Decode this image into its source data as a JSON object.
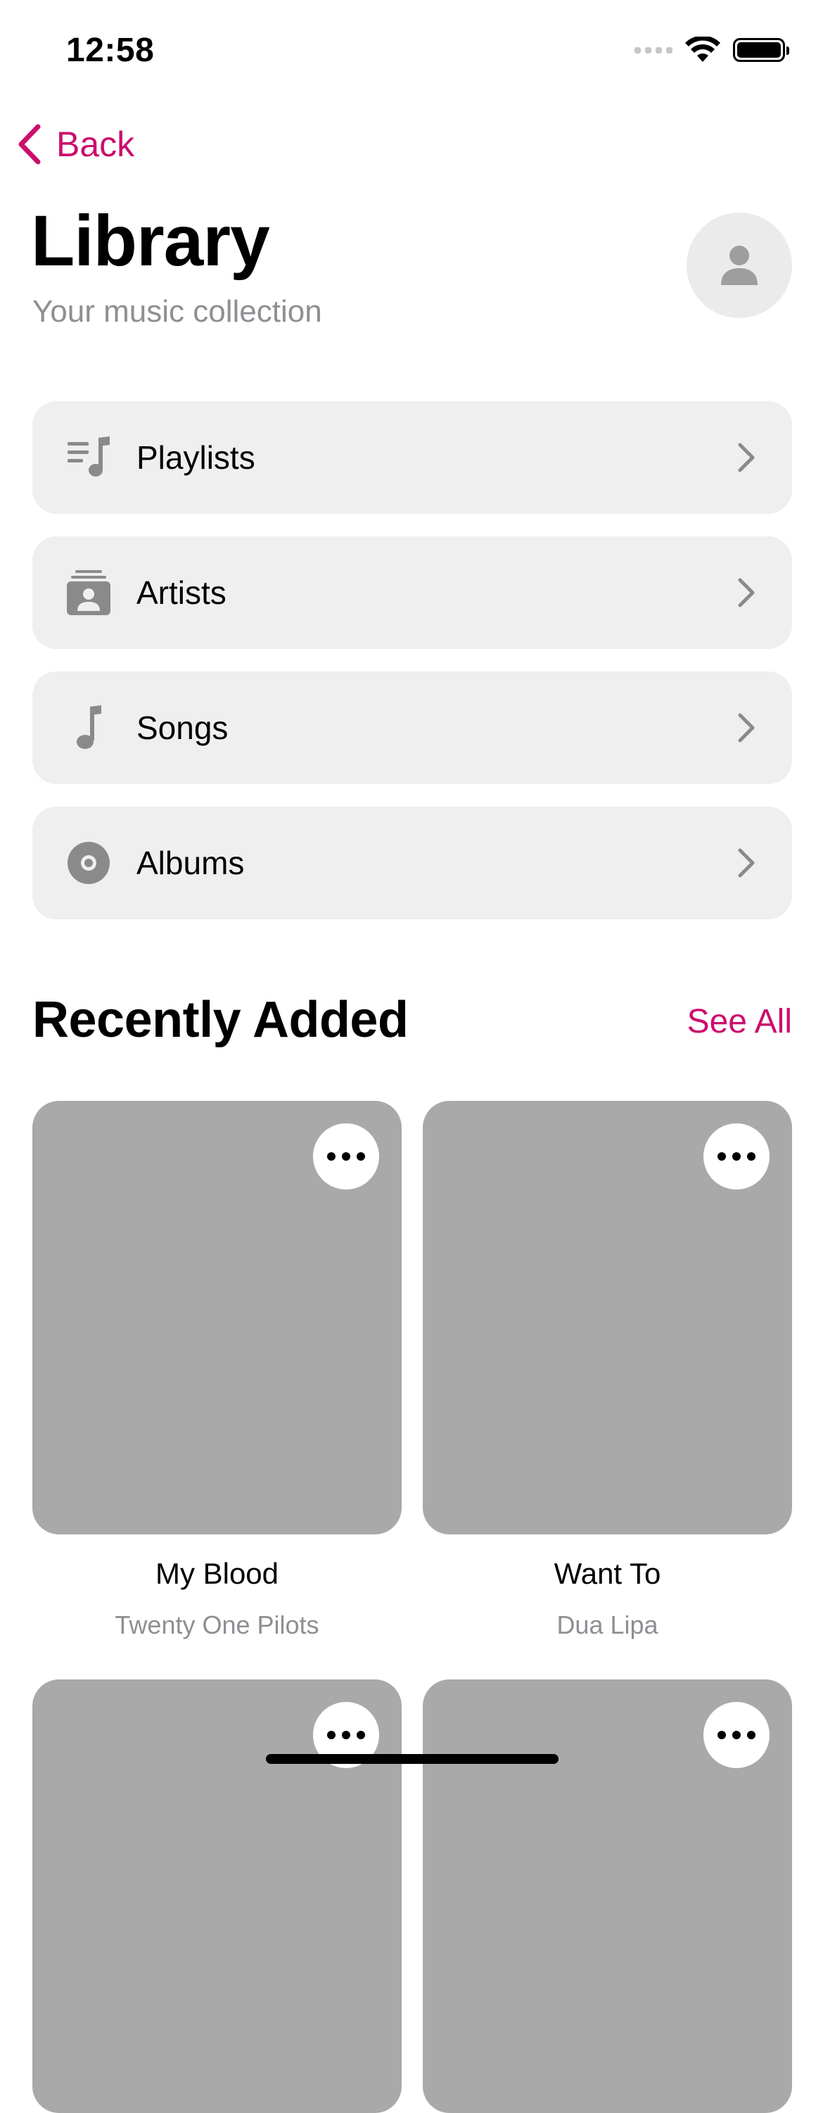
{
  "status_bar": {
    "time": "12:58"
  },
  "nav": {
    "back_label": "Back"
  },
  "header": {
    "title": "Library",
    "subtitle": "Your music collection"
  },
  "menu": [
    {
      "label": "Playlists",
      "icon": "playlist-icon"
    },
    {
      "label": "Artists",
      "icon": "artists-icon"
    },
    {
      "label": "Songs",
      "icon": "music-note-icon"
    },
    {
      "label": "Albums",
      "icon": "album-disc-icon"
    }
  ],
  "recently_added": {
    "title": "Recently Added",
    "see_all_label": "See All",
    "items": [
      {
        "title": "My Blood",
        "artist": "Twenty One Pilots"
      },
      {
        "title": "Want To",
        "artist": "Dua Lipa"
      }
    ]
  },
  "colors": {
    "accent": "#cc0e6d",
    "card_bg": "#efefef",
    "art_placeholder": "#a9a9a9",
    "secondary_text": "#8e8e93"
  }
}
